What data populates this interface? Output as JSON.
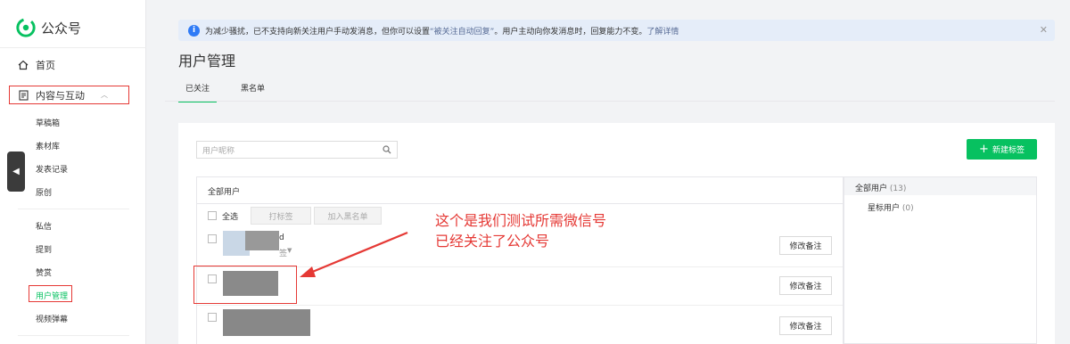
{
  "app": {
    "name": "公众号"
  },
  "sidebar": {
    "home": "首页",
    "content_group": "内容与互动",
    "content_items": [
      "草稿箱",
      "素材库",
      "发表记录",
      "原创"
    ],
    "interaction_items": [
      "私信",
      "提到",
      "赞赏",
      "用户管理",
      "视频弹幕"
    ],
    "active_item": "用户管理"
  },
  "notice": {
    "text_before": "为减少骚扰，已不支持向新关注用户手动发消息，但你可以设置",
    "link_inline": "“被关注自动回复”",
    "text_after": "。用户主动向你发消息时，回复能力不变。",
    "link": "了解详情"
  },
  "page": {
    "title": "用户管理",
    "tabs": [
      {
        "label": "已关注",
        "active": true
      },
      {
        "label": "黑名单",
        "active": false
      }
    ]
  },
  "toolbar": {
    "search_placeholder": "用户昵称",
    "new_tag_label": "新建标签",
    "list_title": "全部用户",
    "select_all": "全选",
    "tag_button": "打标签",
    "blacklist_button": "加入黑名单"
  },
  "users": [
    {
      "name_fragment": "d",
      "tag_fragment": "签",
      "remark_button": "修改备注"
    },
    {
      "remark_button": "修改备注"
    },
    {
      "remark_button": "修改备注"
    }
  ],
  "groups": {
    "all_label": "全部用户",
    "all_count": "(13)",
    "star_label": "星标用户",
    "star_count": "(0)"
  },
  "annotation": {
    "line1": "这个是我们测试所需微信号",
    "line2": "已经关注了公众号",
    "color": "#e53935"
  },
  "colors": {
    "accent": "#07c160",
    "info": "#2f7bf6",
    "link": "#576b95"
  }
}
